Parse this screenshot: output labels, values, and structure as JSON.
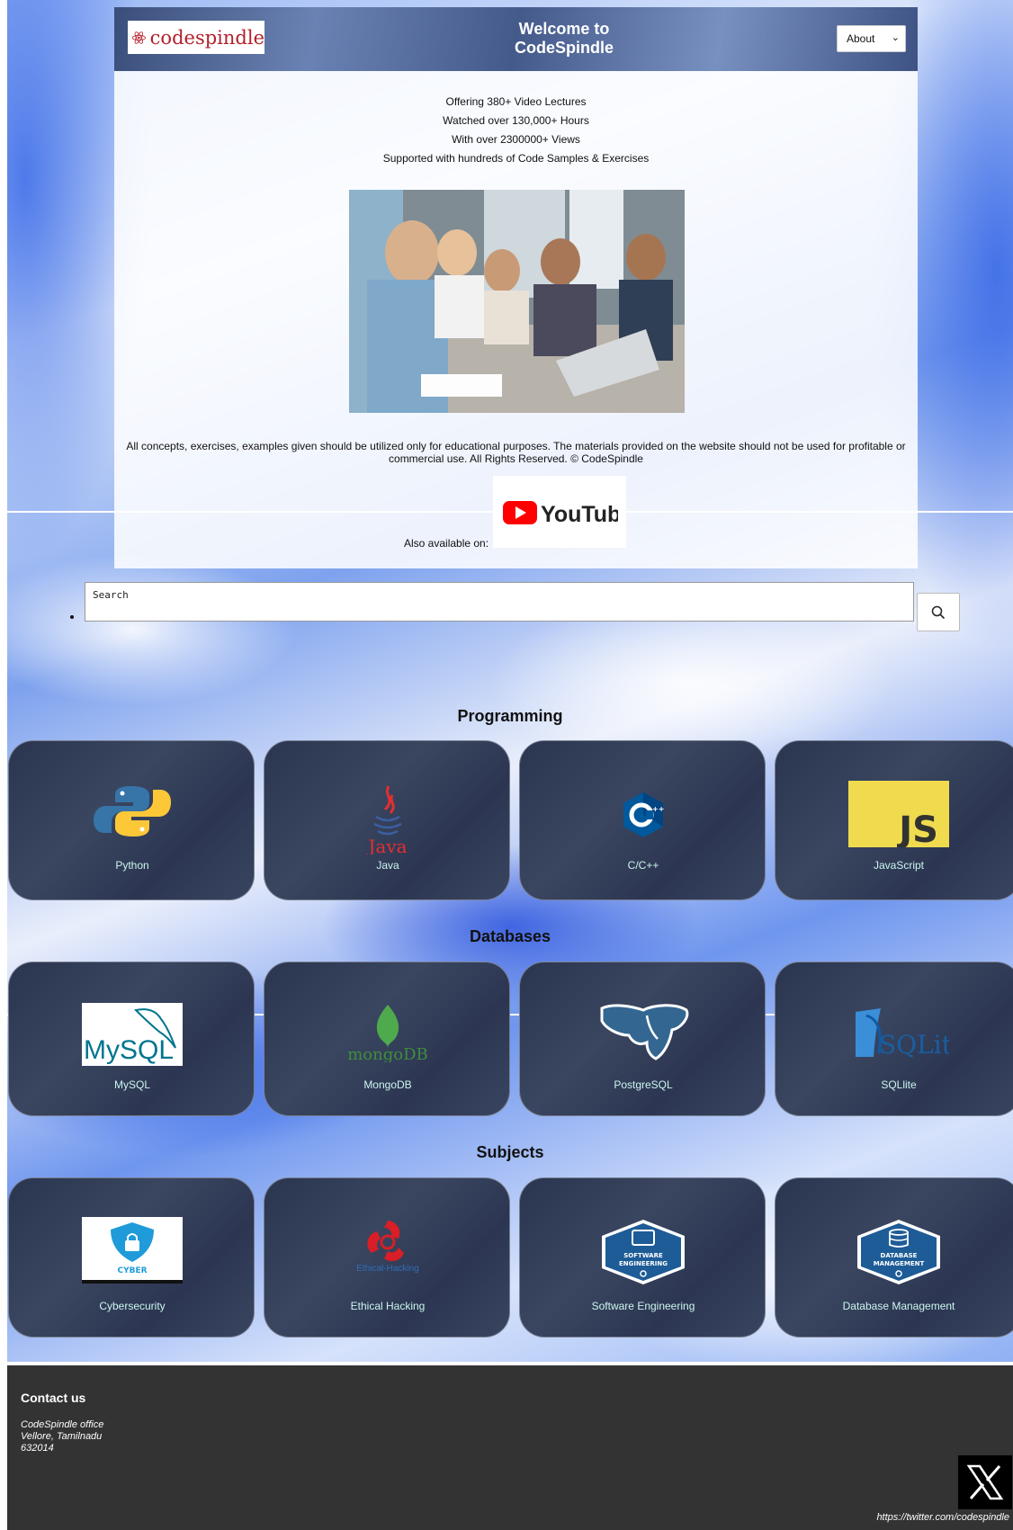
{
  "header": {
    "logo_text": "codespindle",
    "welcome_line1": "Welcome to",
    "welcome_line2": "CodeSpindle",
    "about_select": "About"
  },
  "stats": [
    "Offering 380+ Video Lectures",
    "Watched over 130,000+ Hours",
    "With over 2300000+ Views",
    "Supported with hundreds of Code Samples & Exercises"
  ],
  "disclaimer": "All concepts, exercises, examples given should be utilized only for educational purposes. The materials provided on the website should not be used for profitable or commercial use. All Rights Reserved. © CodeSpindle",
  "also_available": "Also available on:",
  "youtube_logo": "YouTube",
  "search": {
    "placeholder": "Search",
    "icon": "search-icon"
  },
  "sections": {
    "programming": {
      "title": "Programming",
      "items": [
        "Python",
        "Java",
        "C/C++",
        "JavaScript"
      ]
    },
    "databases": {
      "title": "Databases",
      "items": [
        "MySQL",
        "MongoDB",
        "PostgreSQL",
        "SQLlite"
      ]
    },
    "subjects": {
      "title": "Subjects",
      "items": [
        "Cybersecurity",
        "Ethical Hacking",
        "Software Engineering",
        "Database Management"
      ]
    }
  },
  "icon_text": {
    "java": "Java",
    "js": "JS",
    "mysql": "MySQL",
    "mongodb": "mongoDB",
    "sqlite": "SQLite",
    "cyber": "CYBER",
    "hacking": "Ethical-Hacking",
    "software_line1": "SOFTWARE",
    "software_line2": "ENGINEERING",
    "database_line1": "DATABASE",
    "database_line2": "MANAGEMENT"
  },
  "footer": {
    "heading": "Contact us",
    "address_line1": "CodeSpindle office",
    "address_line2": "Vellore, Tamilnadu",
    "address_line3": "632014",
    "twitter_url": "https://twitter.com/codespindle"
  },
  "colors": {
    "header_bar": "#4a5f8f",
    "tile_bg": "#2f3a55",
    "tile_label": "#ccf6ee",
    "footer_bg": "#333333"
  }
}
